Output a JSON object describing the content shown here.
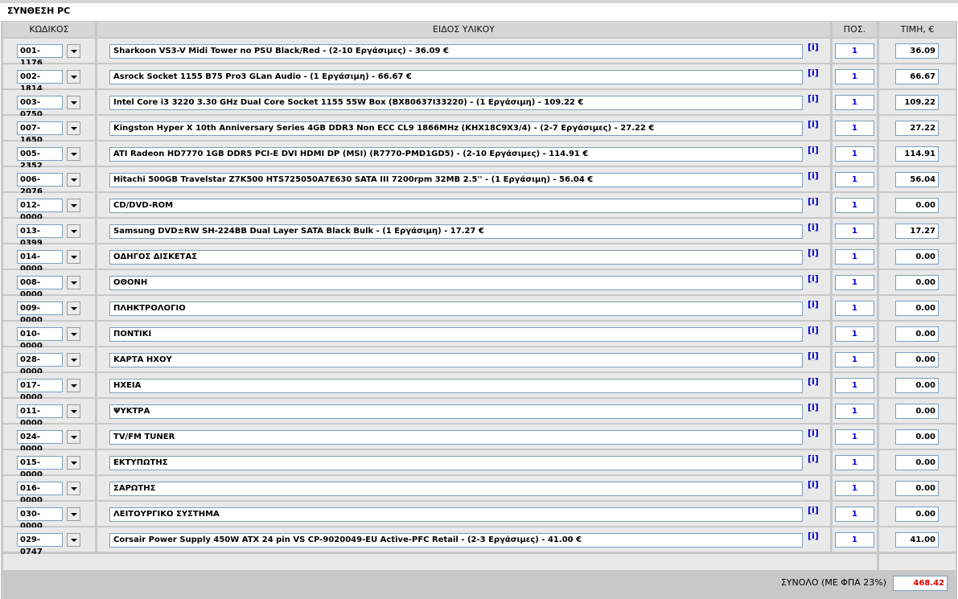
{
  "page": {
    "title": "ΣΥΝΘΕΣΗ PC"
  },
  "headers": {
    "code": "ΚΩΔΙΚΟΣ",
    "item": "ΕΙΔΟΣ ΥΛΙΚΟΥ",
    "qty": "ΠΟΣ.",
    "price": "ΤΙΜΗ, €"
  },
  "info_label": "[i]",
  "rows": [
    {
      "code": "001-1176",
      "item": "Sharkoon VS3-V Midi Tower no PSU Black/Red - (2-10 Εργάσιμες) - 36.09 €",
      "qty": "1",
      "price": "36.09"
    },
    {
      "code": "002-1814",
      "item": "Asrock Socket 1155 B75 Pro3 GLan Audio - (1 Εργάσιμη) - 66.67 €",
      "qty": "1",
      "price": "66.67"
    },
    {
      "code": "003-0750",
      "item": "Intel Core i3 3220 3.30 GHz Dual Core Socket 1155 55W Box (BX80637I33220) - (1 Εργάσιμη) - 109.22 €",
      "qty": "1",
      "price": "109.22"
    },
    {
      "code": "007-1650",
      "item": "Kingston Hyper X 10th Anniversary Series 4GB DDR3 Non ECC CL9 1866MHz (KHX18C9X3/4) - (2-7 Εργάσιμες) - 27.22 €",
      "qty": "1",
      "price": "27.22"
    },
    {
      "code": "005-2352",
      "item": "ATI Radeon HD7770 1GB DDR5 PCI-E DVI HDMI DP (MSI) (R7770-PMD1GD5) - (2-10 Εργάσιμες) - 114.91 €",
      "qty": "1",
      "price": "114.91"
    },
    {
      "code": "006-2076",
      "item": "Hitachi 500GB Travelstar Z7K500 HTS725050A7E630 SATA III 7200rpm 32MB 2.5'' - (1 Εργάσιμη) - 56.04 €",
      "qty": "1",
      "price": "56.04"
    },
    {
      "code": "012-0000",
      "item": "CD/DVD-ROM",
      "qty": "1",
      "price": "0.00"
    },
    {
      "code": "013-0399",
      "item": "Samsung DVD±RW SH-224BB Dual Layer SATA Black Bulk - (1 Εργάσιμη) - 17.27 €",
      "qty": "1",
      "price": "17.27"
    },
    {
      "code": "014-0000",
      "item": "ΟΔΗΓΟΣ ΔΙΣΚΕΤΑΣ",
      "qty": "1",
      "price": "0.00"
    },
    {
      "code": "008-0000",
      "item": "ΟΘΟΝΗ",
      "qty": "1",
      "price": "0.00"
    },
    {
      "code": "009-0000",
      "item": "ΠΛΗΚΤΡΟΛΟΓΙΟ",
      "qty": "1",
      "price": "0.00"
    },
    {
      "code": "010-0000",
      "item": "ΠΟΝΤΙΚΙ",
      "qty": "1",
      "price": "0.00"
    },
    {
      "code": "028-0000",
      "item": "ΚΑΡΤΑ ΗΧΟΥ",
      "qty": "1",
      "price": "0.00"
    },
    {
      "code": "017-0000",
      "item": "ΗΧΕΙΑ",
      "qty": "1",
      "price": "0.00"
    },
    {
      "code": "011-0000",
      "item": "ΨΥΚΤΡΑ",
      "qty": "1",
      "price": "0.00"
    },
    {
      "code": "024-0000",
      "item": "TV/FM TUNER",
      "qty": "1",
      "price": "0.00"
    },
    {
      "code": "015-0000",
      "item": "ΕΚΤΥΠΩΤΗΣ",
      "qty": "1",
      "price": "0.00"
    },
    {
      "code": "016-0000",
      "item": "ΣΑΡΩΤΗΣ",
      "qty": "1",
      "price": "0.00"
    },
    {
      "code": "030-0000",
      "item": "ΛΕΙΤΟΥΡΓΙΚΟ ΣΥΣΤΗΜΑ",
      "qty": "1",
      "price": "0.00"
    },
    {
      "code": "029-0747",
      "item": "Corsair Power Supply 450W ATX 24 pin VS CP-9020049-EU Active-PFC Retail - (2-3 Εργάσιμες) - 41.00 €",
      "qty": "1",
      "price": "41.00"
    }
  ],
  "total": {
    "label": "ΣΥΝΟΛΟ (ΜΕ ΦΠΑ 23%)",
    "value": "468.42"
  },
  "colors": {
    "panel": "#c8c8c8",
    "cell": "#e9e9e9",
    "header": "#d6d6d6",
    "link": "#0000cc",
    "total": "#e00000"
  }
}
